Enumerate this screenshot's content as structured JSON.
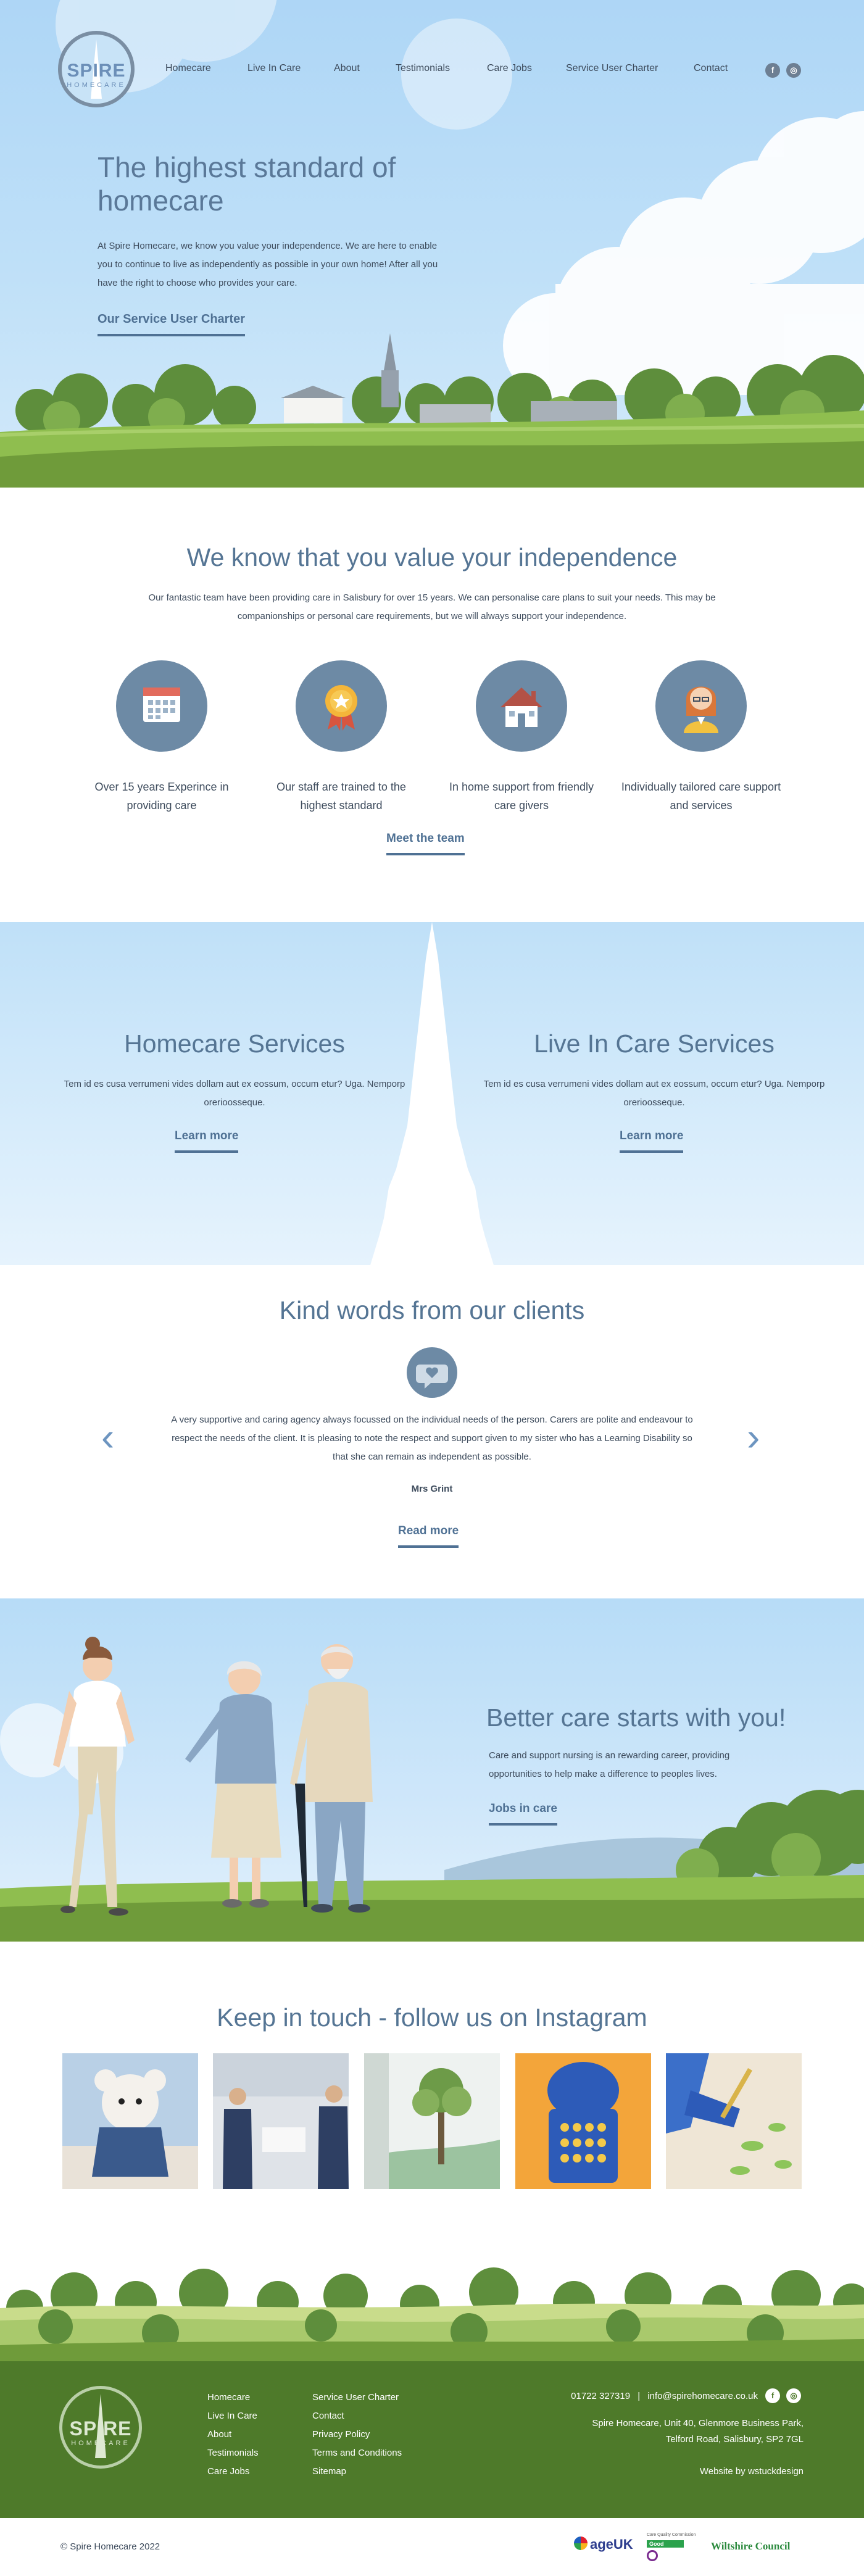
{
  "header": {
    "logo": {
      "brand": "SPIRE",
      "sub": "HOMECARE"
    },
    "nav": [
      "Homecare",
      "Live In Care",
      "About",
      "Testimonials",
      "Care Jobs",
      "Service User Charter",
      "Contact"
    ],
    "social": {
      "facebook": "f",
      "instagram": "◎"
    }
  },
  "hero": {
    "title": "The highest standard of homecare",
    "text": "At Spire Homecare, we know you value your independence. We are here to enable you to continue to live as independently as possible in your own home! After all you have the right to choose who provides your care.",
    "link": "Our Service User Charter"
  },
  "independence": {
    "title": "We know that you value your independence",
    "text": "Our fantastic team have been providing care in Salisbury for over 15 years. We can personalise care plans to suit your needs. This may be companionships or personal care requirements, but we will always support your independence.",
    "features": [
      {
        "icon": "calendar-icon",
        "label": "Over 15 years Experince in providing care"
      },
      {
        "icon": "award-icon",
        "label": "Our staff are trained to the highest standard"
      },
      {
        "icon": "house-icon",
        "label": "In home support from friendly care givers"
      },
      {
        "icon": "carer-icon",
        "label": "Individually tailored care support and services"
      }
    ],
    "link": "Meet the team"
  },
  "services": {
    "homecare": {
      "title": "Homecare Services",
      "text": "Tem id es cusa verrumeni vides dollam aut ex eossum, occum etur? Uga. Nemporp orerioosseque.",
      "link": "Learn more"
    },
    "livein": {
      "title": "Live In Care Services",
      "text": "Tem id es cusa verrumeni vides dollam aut ex eossum, occum etur? Uga. Nemporp orerioosseque.",
      "link": "Learn more"
    }
  },
  "testimonials": {
    "title": "Kind words from our clients",
    "quote": "A very supportive and caring agency always focussed on the individual needs of the person. Carers are polite and endeavour to respect the needs of the client. It is pleasing to note the respect and support given to my sister who has a Learning Disability so that she can remain as independent as possible.",
    "author": "Mrs Grint",
    "link": "Read more",
    "prev": "‹",
    "next": "›"
  },
  "better_care": {
    "title": "Better care starts with you!",
    "text": "Care and support nursing is an rewarding career, providing opportunities to help make a difference to peoples lives.",
    "link": "Jobs in care"
  },
  "instagram": {
    "title": "Keep in touch - follow us on Instagram",
    "posts": [
      "teddy-photo",
      "staff-photo",
      "mural-photo",
      "game-photo",
      "craft-photo"
    ]
  },
  "footer": {
    "logo": {
      "brand": "SPIRE",
      "sub": "HOMECARE"
    },
    "col1": [
      "Homecare",
      "Live In Care",
      "About",
      "Testimonials",
      "Care Jobs"
    ],
    "col2": [
      "Service User Charter",
      "Contact",
      "Privacy Policy",
      "Terms and Conditions",
      "Sitemap"
    ],
    "phone": "01722 327319",
    "separator": "|",
    "email": "info@spirehomecare.co.uk",
    "address_line1": "Spire Homecare, Unit 40, Glenmore Business Park,",
    "address_line2": "Telford Road, Salisbury, SP2 7GL",
    "credit_prefix": "Website by",
    "credit_name": "wstuckdesign",
    "copyright": "© Spire Homecare 2022",
    "partners": {
      "ageuk": "ageUK",
      "cqc": "Care Quality Commission",
      "cqc_short": "Good",
      "wiltshire": "Wiltshire Council"
    }
  },
  "colors": {
    "accent": "#557594",
    "sky": "#aed6f6",
    "grass": "#6f9b3a",
    "footer": "#4e7a2a",
    "icon_bg": "#6d8aa5"
  }
}
